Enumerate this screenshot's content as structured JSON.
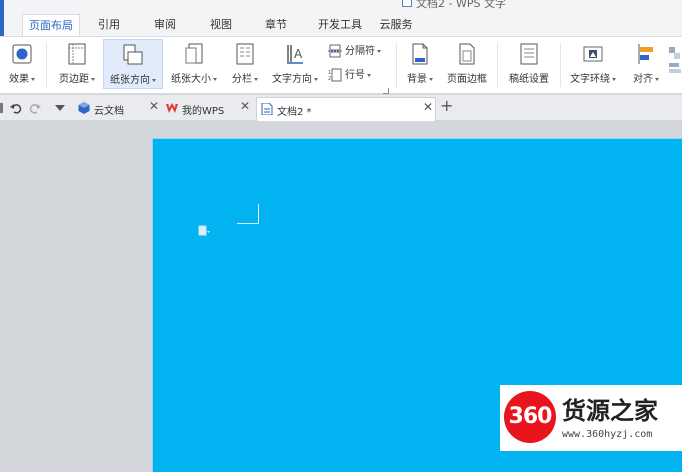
{
  "title_bar": {
    "title": "文档2 - WPS 文字"
  },
  "menu": {
    "tabs": [
      {
        "label": "页面布局",
        "active": true
      },
      {
        "label": "引用"
      },
      {
        "label": "审阅"
      },
      {
        "label": "视图"
      },
      {
        "label": "章节"
      },
      {
        "label": "开发工具"
      },
      {
        "label": "云服务"
      }
    ]
  },
  "ribbon": {
    "effect": "效果",
    "margins": "页边距",
    "orientation": "纸张方向",
    "size": "纸张大小",
    "columns": "分栏",
    "text_direction": "文字方向",
    "separator": "分隔符",
    "line_number": "行号",
    "background": "背景",
    "page_border": "页面边框",
    "draft_settings": "稿纸设置",
    "text_wrap": "文字环绕",
    "align": "对齐"
  },
  "doc_tabs": [
    {
      "label": "云文档"
    },
    {
      "label": "我的WPS"
    },
    {
      "label": "文档2 *",
      "active": true
    }
  ],
  "colors": {
    "accent": "#2b66c8",
    "page_background": "#01b3f0",
    "watermark_red": "#e9141d"
  },
  "watermark": {
    "badge": "360",
    "name": "货源之家",
    "url": "www.360hyzj.com"
  }
}
